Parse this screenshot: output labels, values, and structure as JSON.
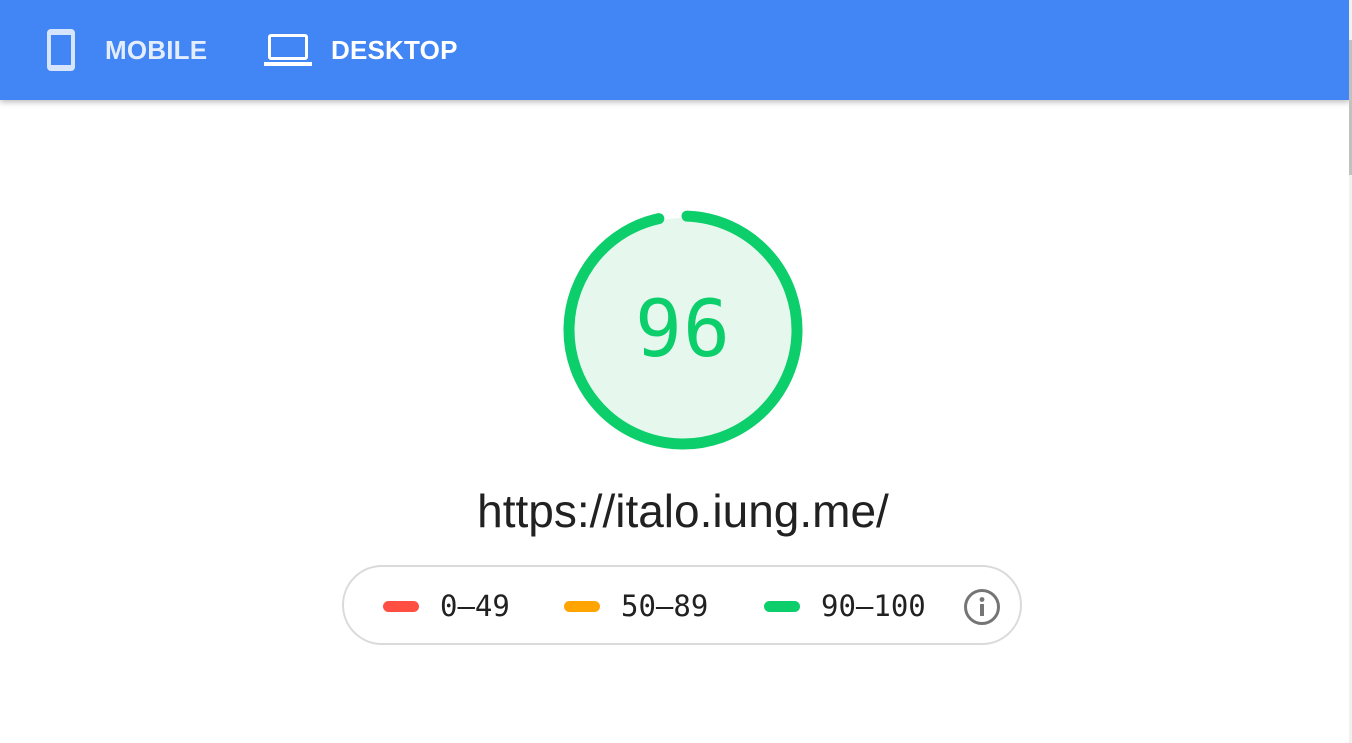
{
  "tabs": [
    {
      "label": "MOBILE",
      "icon": "mobile-phone-icon",
      "selected": false
    },
    {
      "label": "DESKTOP",
      "icon": "laptop-icon",
      "selected": true
    }
  ],
  "colors": {
    "header": "#4285f4",
    "pass": "#0cce6b",
    "pass_fill": "#e6f8ee",
    "average": "#ffa400",
    "fail": "#ff4e42"
  },
  "score": {
    "value": "96",
    "fraction": 0.96
  },
  "url": "https://italo.iung.me/",
  "legend": [
    {
      "range": "0–49",
      "color": "#ff4e42",
      "icon": "fail-swatch"
    },
    {
      "range": "50–89",
      "color": "#ffa400",
      "icon": "average-swatch"
    },
    {
      "range": "90–100",
      "color": "#0cce6b",
      "icon": "pass-swatch"
    }
  ],
  "info_icon": "info-icon"
}
